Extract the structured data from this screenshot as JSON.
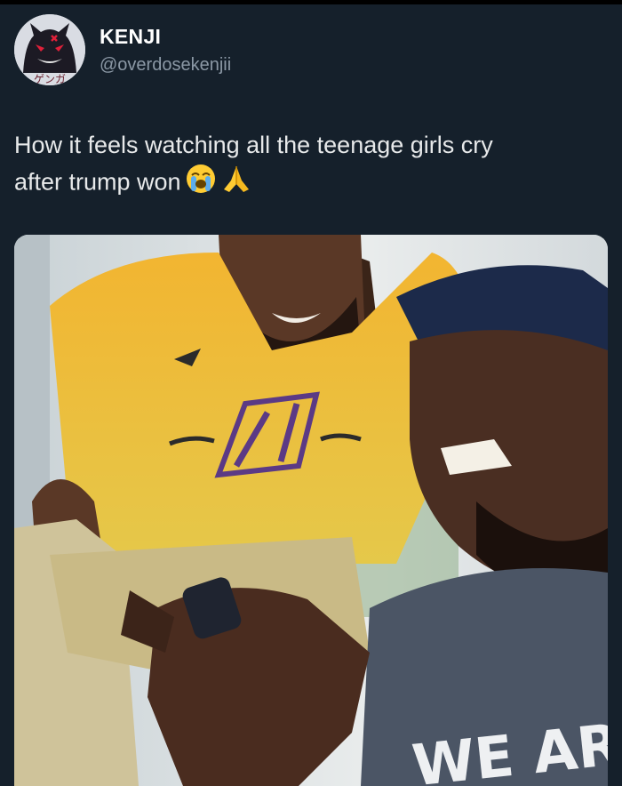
{
  "user": {
    "display_name": "KENJI",
    "handle": "@overdosekenjii",
    "avatar_icon": "ghost-avatar-icon",
    "avatar_text": "ゲンガ"
  },
  "tweet": {
    "text": "How it feels watching all the teenage girls cry",
    "text_line2": "after trump won",
    "emojis": [
      "loudly-crying-face-icon",
      "folded-hands-icon"
    ]
  },
  "media": {
    "jersey_text": "WE ARI"
  },
  "colors": {
    "background": "#15202b",
    "handle": "#8b98a5",
    "text": "#e7e9ea"
  }
}
